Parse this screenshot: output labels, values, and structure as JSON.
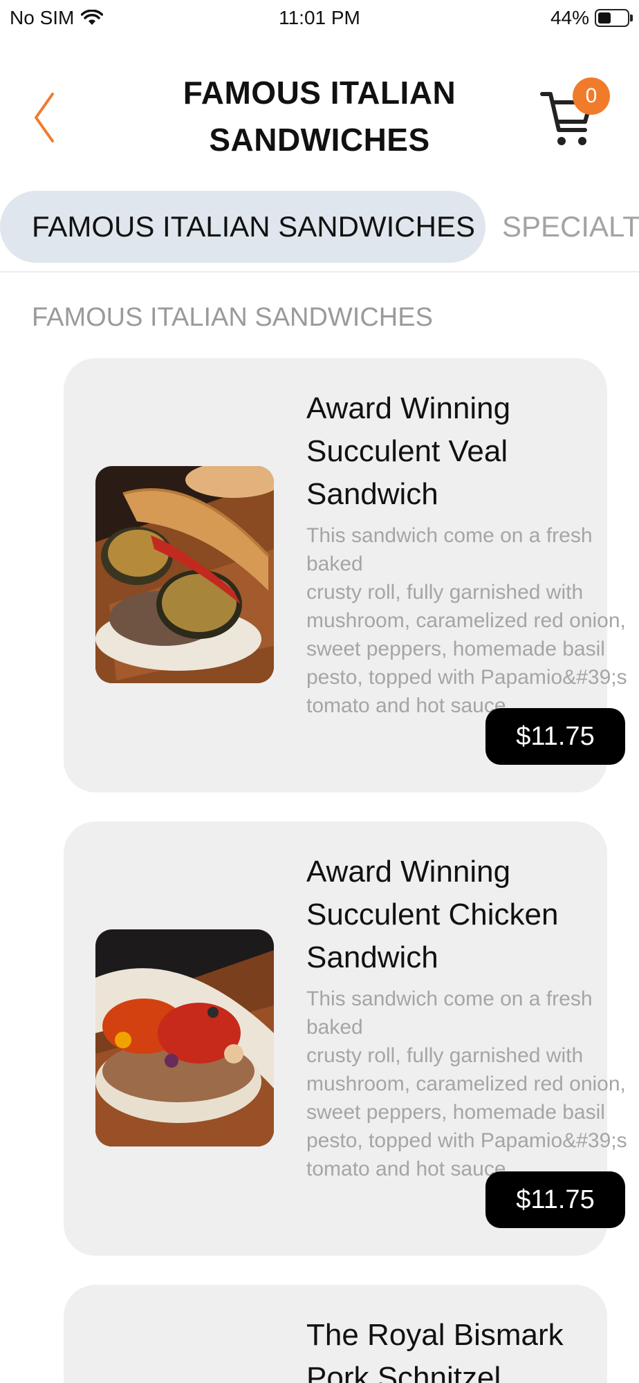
{
  "status_bar": {
    "carrier": "No SIM",
    "time": "11:01 PM",
    "battery_percent": "44%",
    "battery_level": 0.44
  },
  "header": {
    "title_line1": "FAMOUS ITALIAN",
    "title_line2": "SANDWICHES",
    "cart_count": "0",
    "accent_color": "#f07b2b"
  },
  "tabs": [
    {
      "label": "FAMOUS ITALIAN SANDWICHES",
      "active": true
    },
    {
      "label": "SPECIALTY",
      "active": false
    }
  ],
  "section": {
    "title": "FAMOUS ITALIAN SANDWICHES"
  },
  "items": [
    {
      "name_lines": [
        "Award Winning",
        "Succulent Veal",
        "Sandwich"
      ],
      "description_lines": [
        "This sandwich come on a fresh baked",
        "crusty roll, fully garnished with",
        "mushroom, caramelized red onion,",
        "sweet peppers, homemade basil",
        "pesto, topped with Papamio&#39;s",
        "tomato and hot sauce."
      ],
      "price": "$11.75",
      "image": "veal-sandwich-photo"
    },
    {
      "name_lines": [
        "Award Winning",
        "Succulent Chicken",
        "Sandwich"
      ],
      "description_lines": [
        "This sandwich come on a fresh baked",
        "crusty roll, fully garnished with",
        "mushroom, caramelized red onion,",
        "sweet peppers, homemade basil",
        "pesto, topped with Papamio&#39;s",
        "tomato and hot sauce."
      ],
      "price": "$11.75",
      "image": "chicken-sandwich-photo"
    },
    {
      "name_lines": [
        "The Royal Bismark",
        "Pork Schnitzel"
      ],
      "description_lines": [],
      "price": "",
      "image": ""
    }
  ]
}
